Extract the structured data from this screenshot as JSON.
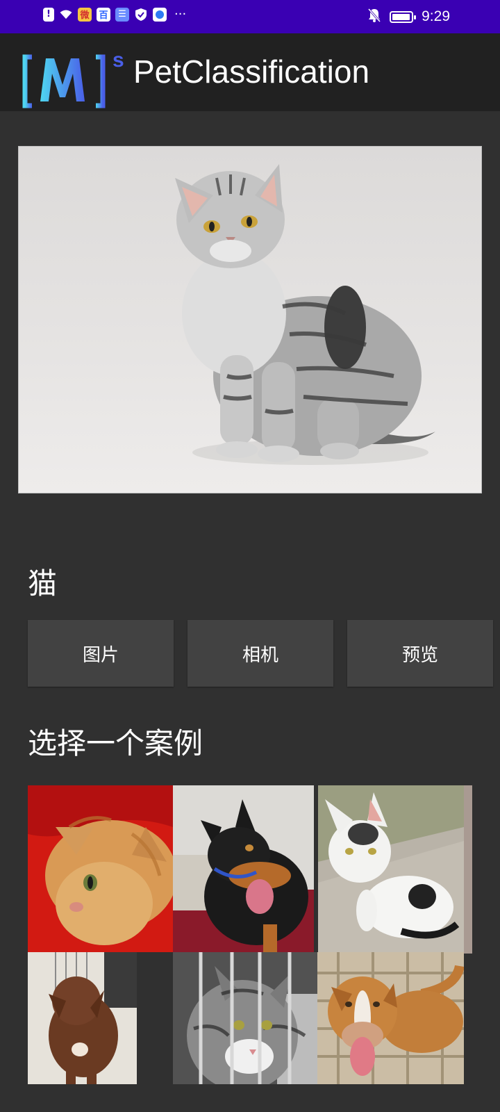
{
  "status_bar": {
    "time": "9:29",
    "bg_color": "#3a00b3",
    "left_icons": [
      "alert-icon",
      "wifi-icon",
      "weibo-icon",
      "baidu-icon",
      "app-icon",
      "shield-icon",
      "browser-icon",
      "more-dots-icon"
    ],
    "more_symbol": "···",
    "battery_level": 0.95
  },
  "app_bar": {
    "title": "PetClassification",
    "logo_text": "[M]",
    "logo_superscript": "s"
  },
  "main": {
    "image": "tabby-cat-photo",
    "result": "猫"
  },
  "buttons": {
    "gallery": "图片",
    "camera": "相机",
    "preview": "预览"
  },
  "examples": {
    "title": "选择一个案例",
    "items": [
      "orange-cat",
      "doberman-dog",
      "white-kitten",
      "brown-dog",
      "tabby-cat-cage",
      "pitbull-dog"
    ]
  }
}
